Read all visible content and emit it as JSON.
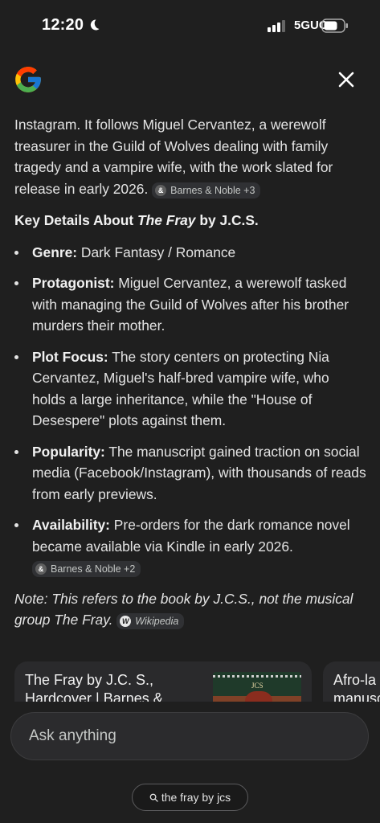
{
  "status_bar": {
    "time": "12:20",
    "network": "5GUC",
    "icons": [
      "moon-icon",
      "signal-icon",
      "battery-icon"
    ]
  },
  "header": {
    "logo": "google-logo",
    "close_icon": "close-icon"
  },
  "answer": {
    "intro": "Instagram. It follows Miguel Cervantez, a werewolf treasurer in the Guild of Wolves dealing with family tragedy and a vampire wife, with the work slated for release in early 2026.",
    "intro_chip": "Barnes & Noble +3",
    "heading_prefix": "Key Details About ",
    "heading_title": "The Fray",
    "heading_suffix": " by J.C.S.",
    "details": [
      {
        "label": "Genre:",
        "text": " Dark Fantasy / Romance"
      },
      {
        "label": "Protagonist:",
        "text": " Miguel Cervantez, a werewolf tasked with managing the Guild of Wolves after his brother murders their mother."
      },
      {
        "label": "Plot Focus:",
        "text": " The story centers on protecting Nia Cervantez, Miguel's half-bred vampire wife, who holds a large inheritance, while the \"House of Desespere\" plots against them."
      },
      {
        "label": "Popularity:",
        "text": " The manuscript gained traction on social media (Facebook/Instagram), with thousands of reads from early previews."
      },
      {
        "label": "Availability:",
        "text": " Pre-orders for the dark romance novel became available via Kindle in early 2026."
      }
    ],
    "availability_chip": "Barnes & Noble +2",
    "note": "Note: This refers to the book by J.C.S., not the musical group The Fray.",
    "note_chip": "Wikipedia"
  },
  "cards": [
    {
      "title": "The Fray by J.C. S., Hardcover | Barnes &",
      "thumb_text": "JCS"
    },
    {
      "title": "Afro-la manusc"
    }
  ],
  "ask": {
    "placeholder": "Ask anything"
  },
  "query": {
    "text": "the fray by jcs"
  },
  "colors": {
    "background": "#1f1f1f",
    "chip": "#303134",
    "text": "#e3e3e3"
  }
}
